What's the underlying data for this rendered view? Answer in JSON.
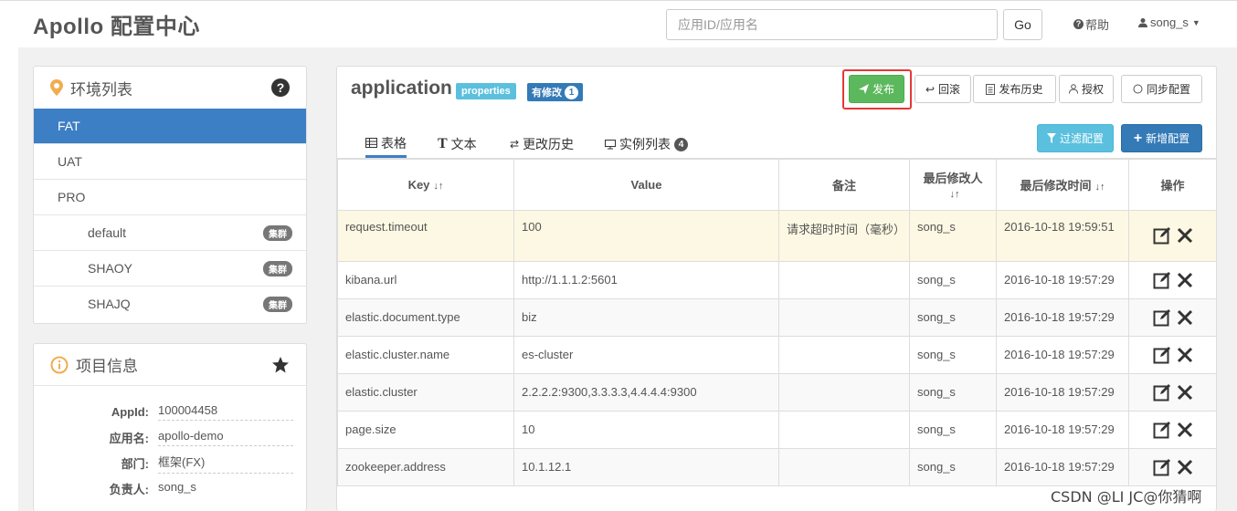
{
  "header": {
    "logo": "Apollo 配置中心",
    "search_placeholder": "应用ID/应用名",
    "go_label": "Go",
    "help_label": "帮助",
    "user_label": "song_s"
  },
  "env_panel": {
    "title": "环境列表",
    "envs": [
      {
        "name": "FAT",
        "active": true
      },
      {
        "name": "UAT"
      },
      {
        "name": "PRO"
      }
    ],
    "clusters": [
      {
        "name": "default",
        "badge": "集群"
      },
      {
        "name": "SHAOY",
        "badge": "集群"
      },
      {
        "name": "SHAJQ",
        "badge": "集群"
      }
    ]
  },
  "project_info": {
    "title": "项目信息",
    "rows": [
      {
        "label": "AppId:",
        "value": "100004458"
      },
      {
        "label": "应用名:",
        "value": "apollo-demo"
      },
      {
        "label": "部门:",
        "value": "框架(FX)"
      },
      {
        "label": "负责人:",
        "value": "song_s"
      }
    ]
  },
  "namespace": {
    "name": "application",
    "format_label": "properties",
    "modified_label": "有修改",
    "modified_count": "1",
    "buttons": {
      "publish": "发布",
      "rollback": "回滚",
      "history": "发布历史",
      "auth": "授权",
      "sync": "同步配置",
      "filter": "过滤配置",
      "add": "新增配置"
    },
    "tabs": [
      {
        "label": "表格",
        "active": true
      },
      {
        "label": "文本"
      },
      {
        "label": "更改历史"
      },
      {
        "label": "实例列表",
        "count": "4"
      }
    ],
    "table": {
      "columns": [
        "Key",
        "Value",
        "备注",
        "最后修改人",
        "最后修改时间",
        "操作"
      ],
      "rows": [
        {
          "key": "request.timeout",
          "value": "100",
          "comment": "请求超时时间（毫秒）",
          "modifier": "song_s",
          "time": "2016-10-18 19:59:51",
          "modified": true
        },
        {
          "key": "kibana.url",
          "value": "http://1.1.1.2:5601",
          "comment": "",
          "modifier": "song_s",
          "time": "2016-10-18 19:57:29"
        },
        {
          "key": "elastic.document.type",
          "value": "biz",
          "comment": "",
          "modifier": "song_s",
          "time": "2016-10-18 19:57:29"
        },
        {
          "key": "elastic.cluster.name",
          "value": "es-cluster",
          "comment": "",
          "modifier": "song_s",
          "time": "2016-10-18 19:57:29"
        },
        {
          "key": "elastic.cluster",
          "value": "2.2.2.2:9300,3.3.3.3,4.4.4.4:9300",
          "comment": "",
          "modifier": "song_s",
          "time": "2016-10-18 19:57:29"
        },
        {
          "key": "page.size",
          "value": "10",
          "comment": "",
          "modifier": "song_s",
          "time": "2016-10-18 19:57:29"
        },
        {
          "key": "zookeeper.address",
          "value": "10.1.12.1",
          "comment": "",
          "modifier": "song_s",
          "time": "2016-10-18 19:57:29"
        }
      ]
    }
  },
  "watermark": "CSDN @LI JC@你猜啊"
}
